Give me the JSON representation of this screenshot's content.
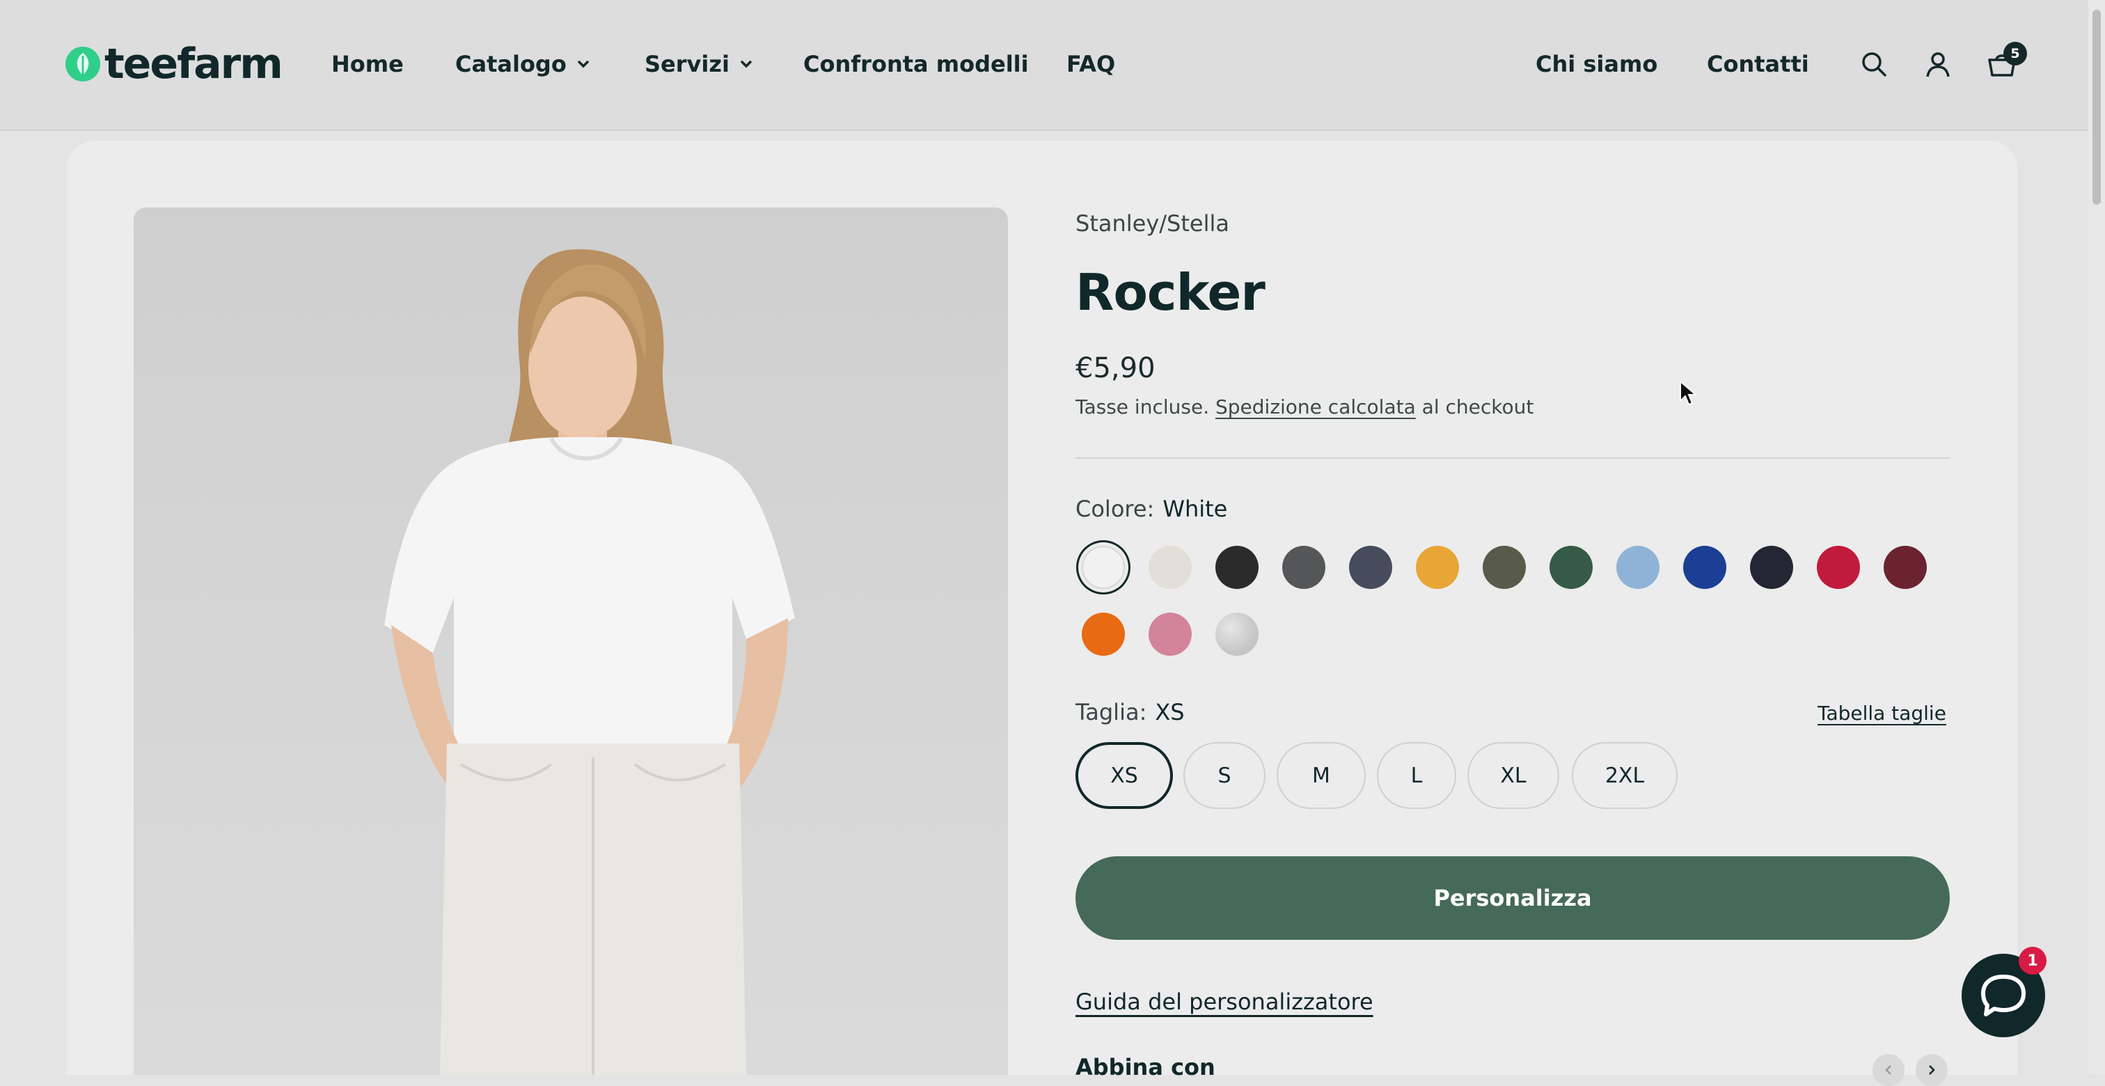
{
  "header": {
    "logo_text": "teefarm",
    "nav": [
      {
        "label": "Home",
        "dropdown": false
      },
      {
        "label": "Catalogo",
        "dropdown": true
      },
      {
        "label": "Servizi",
        "dropdown": true
      },
      {
        "label": "Confronta modelli",
        "dropdown": false
      },
      {
        "label": "FAQ",
        "dropdown": false
      }
    ],
    "right_nav": [
      {
        "label": "Chi siamo"
      },
      {
        "label": "Contatti"
      }
    ],
    "icons": [
      "search-icon",
      "account-icon",
      "cart-icon"
    ],
    "cart_count": "5"
  },
  "product": {
    "brand": "Stanley/Stella",
    "title": "Rocker",
    "price": "€5,90",
    "tax_prefix": "Tasse incluse.",
    "shipping_link": "Spedizione calcolata",
    "tax_suffix": "al checkout",
    "color_label": "Colore:",
    "color_value": "White",
    "colors": [
      "#f1f1f1",
      "#e2ded8",
      "#2b2b2b",
      "#555657",
      "#464c5c",
      "#e8a637",
      "#585a4a",
      "#355a45",
      "#8fb3d6",
      "#1b3f95",
      "#252634",
      "#c01a3c",
      "#6b2330",
      "#e86a12",
      "#d3849a",
      "#cfcfcf"
    ],
    "selected_color_index": 0,
    "size_label": "Taglia:",
    "size_value": "XS",
    "size_chart_link": "Tabella taglie",
    "sizes": [
      "XS",
      "S",
      "M",
      "L",
      "XL",
      "2XL"
    ],
    "selected_size_index": 0,
    "cta_label": "Personalizza",
    "guide_link": "Guida del personalizzatore",
    "pair_heading": "Abbina con"
  },
  "chat": {
    "badge_count": "1"
  },
  "colors": {
    "accent": "#456a59",
    "text_dark": "#10282a",
    "logo_green": "#2fcf8a",
    "badge_red": "#d81b45"
  }
}
